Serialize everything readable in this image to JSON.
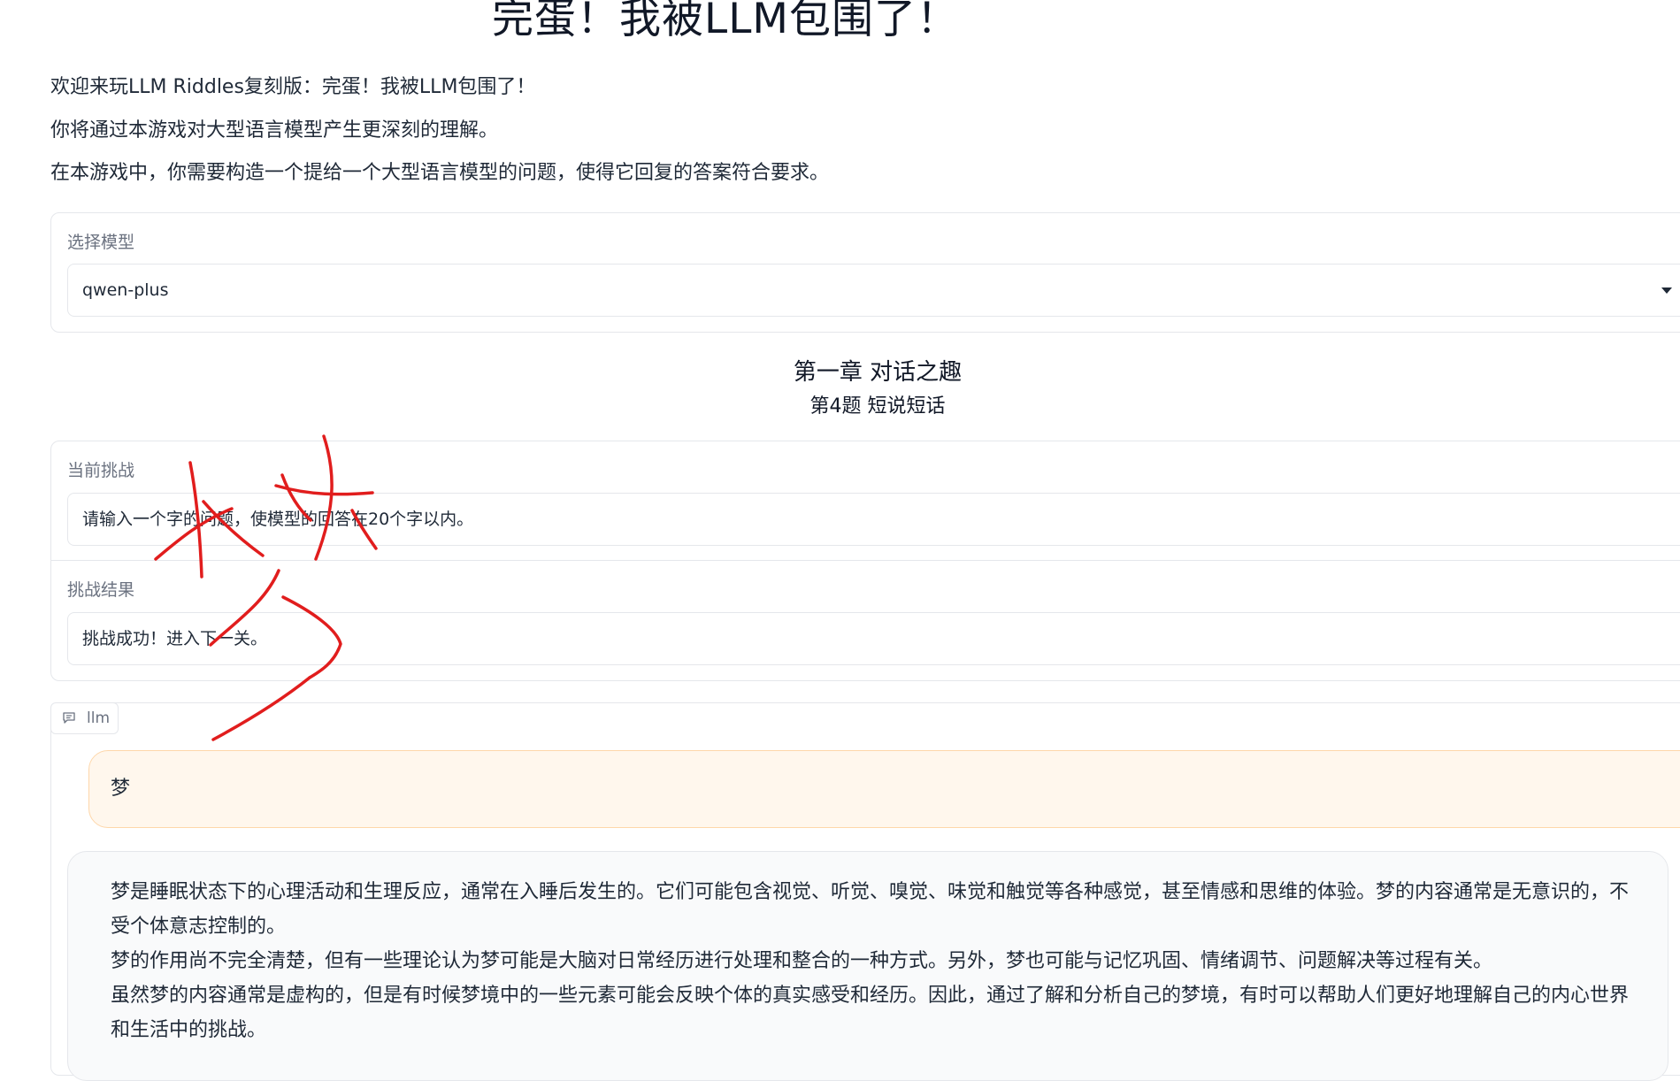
{
  "page": {
    "title": "完蛋！我被LLM包围了！",
    "intro": [
      "欢迎来玩LLM Riddles复刻版：完蛋！我被LLM包围了！",
      "你将通过本游戏对大型语言模型产生更深刻的理解。",
      "在本游戏中，你需要构造一个提给一个大型语言模型的问题，使得它回复的答案符合要求。"
    ]
  },
  "model_select": {
    "label": "选择模型",
    "value": "qwen-plus"
  },
  "chapter": {
    "title": "第一章 对话之趣",
    "level": "第4题 短说短话"
  },
  "challenge": {
    "label": "当前挑战",
    "text": "请输入一个字的问题，使模型的回答在20个字以内。"
  },
  "result": {
    "label": "挑战结果",
    "text": "挑战成功！进入下一关。"
  },
  "chat": {
    "tag_label": "llm",
    "tag_icon": "chat-bubble-icon",
    "user_message": "梦",
    "bot_message": [
      "梦是睡眠状态下的心理活动和生理反应，通常在入睡后发生的。它们可能包含视觉、听觉、嗅觉、味觉和触觉等各种感觉，甚至情感和思维的体验。梦的内容通常是无意识的，不受个体意志控制的。",
      "梦的作用尚不完全清楚，但有一些理论认为梦可能是大脑对日常经历进行处理和整合的一种方式。另外，梦也可能与记忆巩固、情绪调节、问题解决等过程有关。",
      "虽然梦的内容通常是虚构的，但是有时候梦境中的一些元素可能会反映个体的真实感受和经历。因此，通过了解和分析自己的梦境，有时可以帮助人们更好地理解自己的内心世界和生活中的挑战。"
    ]
  },
  "colors": {
    "user_bubble_bg": "#fff7ed",
    "user_bubble_border": "#fed7aa",
    "bot_bubble_bg": "#f9fafb",
    "annotation": "#e11d1d"
  }
}
